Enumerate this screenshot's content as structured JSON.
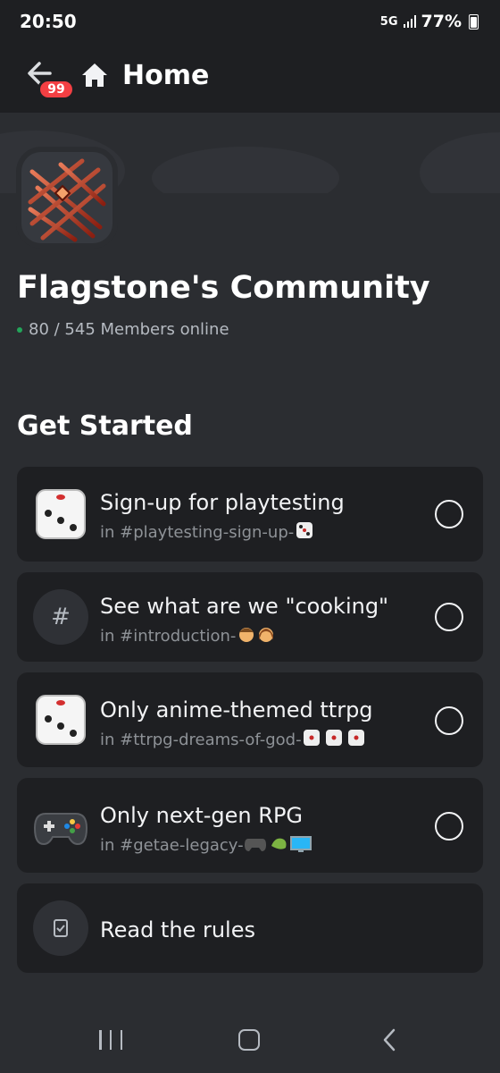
{
  "status_bar": {
    "time": "20:50",
    "network": "5G",
    "battery": "77%"
  },
  "header": {
    "notification_count": "99",
    "title": "Home"
  },
  "server": {
    "name": "Flagstone's Community",
    "online": "80 / 545 Members online"
  },
  "section_title": "Get Started",
  "tasks": [
    {
      "title": "Sign-up for playtesting",
      "channel": "in #playtesting-sign-up-",
      "icon": "dice-icon",
      "done": false
    },
    {
      "title": "See what are we \"cooking\"",
      "channel": "in #introduction-",
      "icon": "hash-icon",
      "done": false
    },
    {
      "title": "Only anime-themed ttrpg",
      "channel": "in #ttrpg-dreams-of-god-",
      "icon": "dice-icon",
      "done": false
    },
    {
      "title": "Only next-gen RPG",
      "channel": "in #getae-legacy-",
      "icon": "gamepad-icon",
      "done": false
    },
    {
      "title": "Read the rules",
      "icon": "rulebook-icon"
    }
  ],
  "hash_glyph": "#",
  "colors": {
    "background": "#2b2d31",
    "card": "#1e1f22",
    "online": "#23a55a",
    "badge": "#f23f43"
  }
}
